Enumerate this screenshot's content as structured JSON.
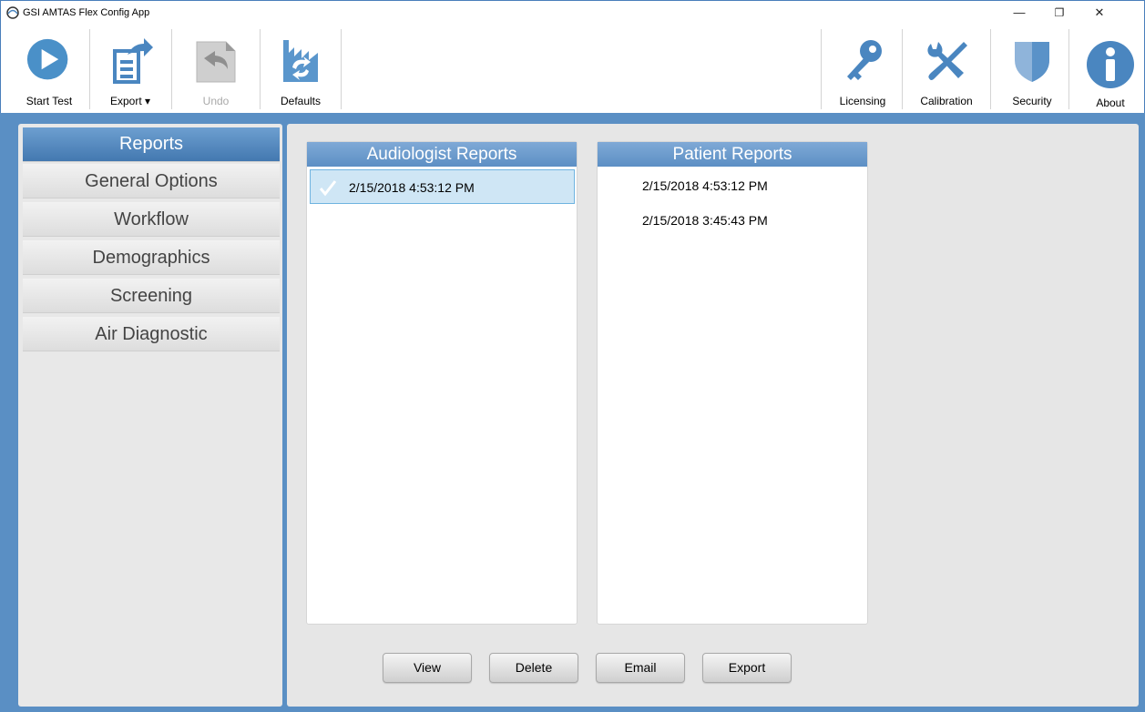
{
  "window": {
    "title": "GSI AMTAS Flex Config App",
    "minimize": "—",
    "restore": "❐",
    "close": "✕"
  },
  "toolbar": {
    "left": [
      {
        "label": "Start Test",
        "icon": "play-icon",
        "enabled": true
      },
      {
        "label": "Export ▾",
        "icon": "export-icon",
        "enabled": true
      },
      {
        "label": "Undo",
        "icon": "undo-icon",
        "enabled": false
      },
      {
        "label": "Defaults",
        "icon": "defaults-icon",
        "enabled": true
      }
    ],
    "right": [
      {
        "label": "Licensing",
        "icon": "key-icon"
      },
      {
        "label": "Calibration",
        "icon": "tools-icon"
      },
      {
        "label": "Security",
        "icon": "shield-icon"
      },
      {
        "label": "About",
        "icon": "info-icon"
      }
    ]
  },
  "sidebar": {
    "items": [
      {
        "label": "Reports",
        "active": true
      },
      {
        "label": "General Options",
        "active": false
      },
      {
        "label": "Workflow",
        "active": false
      },
      {
        "label": "Demographics",
        "active": false
      },
      {
        "label": "Screening",
        "active": false
      },
      {
        "label": "Air Diagnostic",
        "active": false
      }
    ]
  },
  "audiologist_reports": {
    "header": "Audiologist Reports",
    "rows": [
      {
        "text": "2/15/2018 4:53:12 PM",
        "selected": true
      }
    ]
  },
  "patient_reports": {
    "header": "Patient Reports",
    "rows": [
      {
        "text": "2/15/2018 4:53:12 PM"
      },
      {
        "text": "2/15/2018 3:45:43 PM"
      }
    ]
  },
  "actions": {
    "view": "View",
    "delete": "Delete",
    "email": "Email",
    "export": "Export"
  },
  "colors": {
    "accent": "#4a86c0",
    "frame": "#5a8fc4",
    "selected_row": "#cfe6f5"
  }
}
